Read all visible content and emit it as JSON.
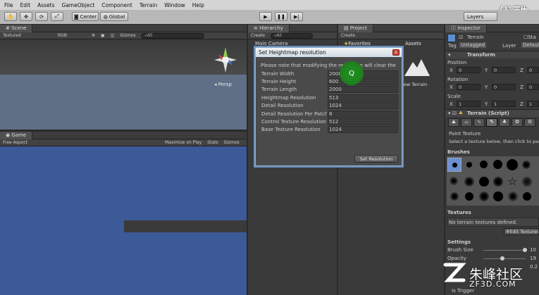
{
  "menu": [
    "File",
    "Edit",
    "Assets",
    "GameObject",
    "Component",
    "Terrain",
    "Window",
    "Help"
  ],
  "toolbar": {
    "center_label": "Center",
    "global_label": "Global",
    "layers_label": "Layers",
    "watermark_top": "优酷"
  },
  "scene": {
    "tab": "Scene",
    "shading": "Textured",
    "render": "RGB",
    "gizmos": "Gizmos",
    "search": "All",
    "persp": "Persp"
  },
  "game": {
    "tab": "Game",
    "aspect": "Free Aspect",
    "maximize": "Maximize on Play",
    "stats": "Stats",
    "gizmos": "Gizmos"
  },
  "hierarchy": {
    "tab": "Hierarchy",
    "create": "Create",
    "search": "All",
    "items": [
      "Main Camera"
    ]
  },
  "project": {
    "tab": "Project",
    "create": "Create",
    "favorites": "Favorites",
    "assets": "Assets",
    "asset_item": "New Terrain"
  },
  "dialog": {
    "title": "Set Heightmap resolution",
    "close": "x",
    "note": "Please note that modifying the resolution will clear the",
    "rows": [
      {
        "label": "Terrain Width",
        "value": "2000"
      },
      {
        "label": "Terrain Height",
        "value": "600"
      },
      {
        "label": "Terrain Length",
        "value": "2000"
      },
      {
        "label": "Heightmap Resolution",
        "value": "513"
      },
      {
        "label": "Detail Resolution",
        "value": "1024"
      },
      {
        "label": "Detail Resolution Per Patch",
        "value": "8"
      },
      {
        "label": "Control Texture Resolution",
        "value": "512"
      },
      {
        "label": "Base Texture Resolution",
        "value": "1024"
      }
    ],
    "set_button": "Set Resolution"
  },
  "inspector": {
    "tab": "Inspector",
    "object_name": "Terrain",
    "static_label": "Sta",
    "tag_label": "Tag",
    "tag_value": "Untagged",
    "layer_label": "Layer",
    "layer_value": "Default",
    "transform": "Transform",
    "position": "Position",
    "rotation": "Rotation",
    "scale": "Scale",
    "position_values": [
      "0",
      "0",
      "0"
    ],
    "rotation_values": [
      "0",
      "0",
      "0"
    ],
    "scale_values": [
      "1",
      "1",
      "1"
    ],
    "axis": [
      "X",
      "Y",
      "Z"
    ],
    "terrain_script": "Terrain (Script)",
    "paint_texture": "Paint Texture",
    "paint_hint": "Select a texture below, then click to pain",
    "brushes": "Brushes",
    "textures": "Textures",
    "no_textures": "No terrain textures defined.",
    "edit_textures": "Edit Textures",
    "settings": "Settings",
    "brush_size_label": "Brush Size",
    "brush_size_value": "10",
    "opacity_label": "Opacity",
    "opacity_value": "19",
    "target_strength_value": "0.2",
    "is_trigger_label": "Is Trigger"
  },
  "watermark": {
    "brand": "朱峰社区",
    "url": "ZF3D.COM"
  },
  "cursor_letter": "Q",
  "colors": {
    "game_bg": "#3d5a98",
    "scene_sky": "#5f6f86",
    "dialog_border": "#8fb3d9",
    "cursor_highlight": "#1f7a1f"
  }
}
